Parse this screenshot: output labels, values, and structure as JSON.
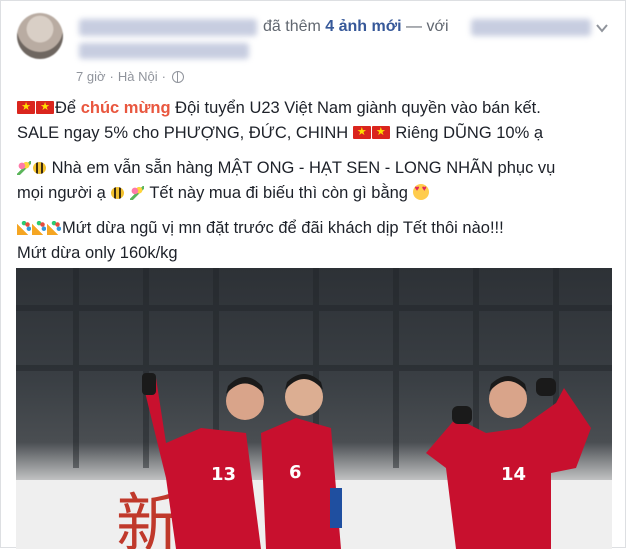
{
  "post": {
    "header": {
      "action_text": "đã thêm",
      "photos_link": "4 ảnh mới",
      "with_text": "— với"
    },
    "meta": {
      "time": "7 giờ",
      "separator": "·",
      "location": "Hà Nội",
      "audience_icon": "globe-icon"
    },
    "body": {
      "p1_prefix": "Để",
      "p1_highlight": "chúc mừng",
      "p1_rest": "Đội tuyển U23 Việt Nam giành quyền vào bán kết.",
      "p1_line2": "SALE ngay 5% cho PHƯỢNG, ĐỨC, CHINH",
      "p1_line2_end": "Riêng DŨNG 10% ạ",
      "p2_line1": "Nhà em vẫn sẵn hàng MẬT ONG - HẠT SEN - LONG NHÃN phục vụ",
      "p2_line2a": "mọi người ạ",
      "p2_line2b": "Tết này mua đi biếu thì còn gì bằng",
      "p3_line1": "Mứt dừa ngũ vị mn đặt trước để đãi khách dịp Tết thôi nào!!!",
      "p3_line2": "Mứt dừa only 160k/kg"
    },
    "photo": {
      "jersey_numbers": [
        "13",
        "6",
        "14"
      ],
      "banner_text": "新"
    },
    "colors": {
      "link": "#365899",
      "highlight": "#e9573f",
      "meta": "#90949c",
      "flag_red": "#da251d",
      "jersey_red": "#c8102e"
    }
  }
}
